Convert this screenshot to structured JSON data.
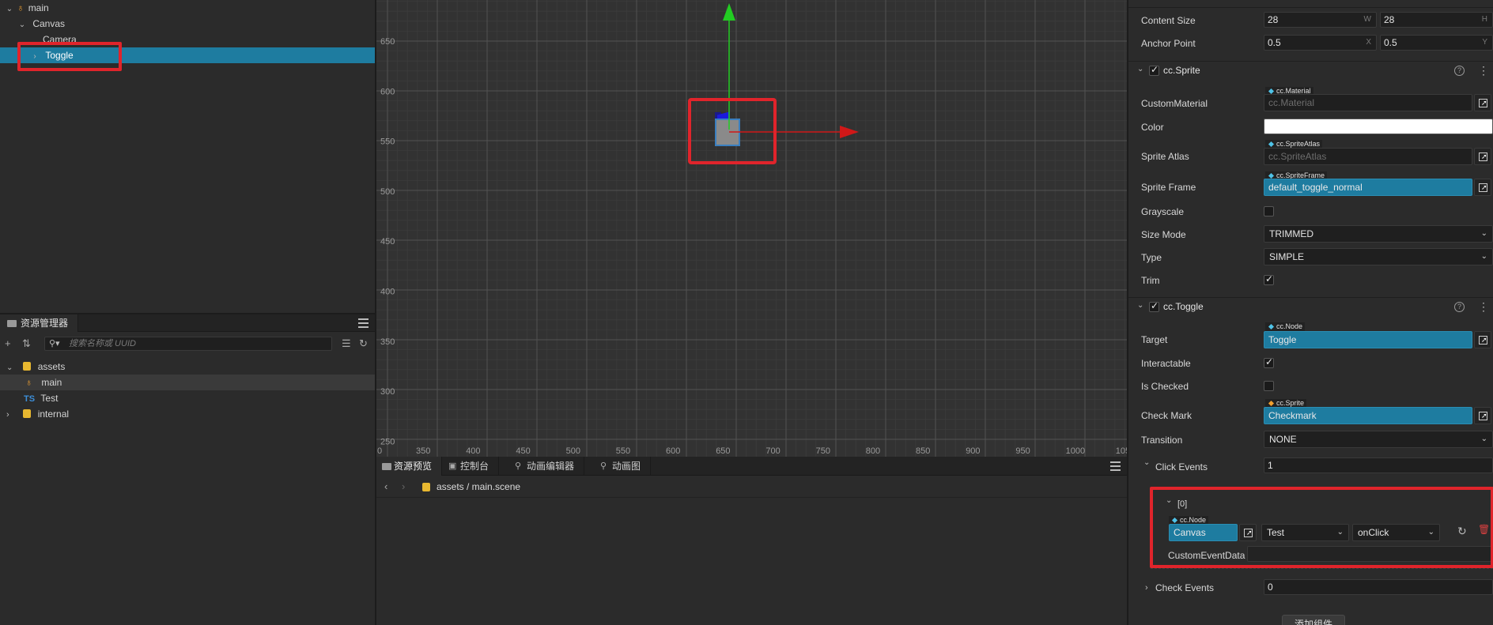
{
  "hierarchy": {
    "root": "main",
    "canvas": "Canvas",
    "camera": "Camera",
    "toggle": "Toggle"
  },
  "assets_panel": {
    "tab_label": "资源管理器",
    "search_placeholder": "搜索名称或 UUID",
    "items": {
      "assets": "assets",
      "main": "main",
      "test": "Test",
      "internal": "internal"
    },
    "ts_badge": "TS"
  },
  "scene": {
    "y_ticks": [
      "650",
      "600",
      "550",
      "500",
      "450",
      "400",
      "350",
      "300",
      "250"
    ],
    "x_ticks": [
      "0",
      "350",
      "400",
      "450",
      "500",
      "550",
      "600",
      "650",
      "700",
      "750",
      "800",
      "850",
      "900",
      "950",
      "1000",
      "105"
    ],
    "gizmo_colors": {
      "x_axis": "#d01818",
      "y_axis": "#22cc22",
      "z_axis": "#1a1adc",
      "highlight": "#e0242b"
    }
  },
  "bottom_panel": {
    "tabs": [
      "资源预览",
      "控制台",
      "动画编辑器",
      "动画图"
    ],
    "path": "assets / main.scene"
  },
  "inspector": {
    "content_size": {
      "label": "Content Size",
      "w": "28",
      "w_unit": "W",
      "h": "28",
      "h_unit": "H"
    },
    "anchor_point": {
      "label": "Anchor Point",
      "x": "0.5",
      "x_unit": "X",
      "y": "0.5",
      "y_unit": "Y"
    },
    "sprite": {
      "title": "cc.Sprite",
      "custom_material": {
        "label": "CustomMaterial",
        "tag": "cc.Material",
        "value": "cc.Material"
      },
      "color": {
        "label": "Color",
        "value": "#ffffff"
      },
      "sprite_atlas": {
        "label": "Sprite Atlas",
        "tag": "cc.SpriteAtlas",
        "value": "cc.SpriteAtlas"
      },
      "sprite_frame": {
        "label": "Sprite Frame",
        "tag": "cc.SpriteFrame",
        "value": "default_toggle_normal"
      },
      "grayscale": {
        "label": "Grayscale",
        "checked": false
      },
      "size_mode": {
        "label": "Size Mode",
        "value": "TRIMMED"
      },
      "type": {
        "label": "Type",
        "value": "SIMPLE"
      },
      "trim": {
        "label": "Trim",
        "checked": true
      }
    },
    "toggle": {
      "title": "cc.Toggle",
      "target": {
        "label": "Target",
        "tag": "cc.Node",
        "value": "Toggle"
      },
      "interactable": {
        "label": "Interactable",
        "checked": true
      },
      "is_checked": {
        "label": "Is Checked",
        "checked": false
      },
      "check_mark": {
        "label": "Check Mark",
        "tag": "cc.Sprite",
        "value": "Checkmark"
      },
      "transition": {
        "label": "Transition",
        "value": "NONE"
      },
      "click_events": {
        "label": "Click Events",
        "count": "1"
      },
      "event0": {
        "index": "[0]",
        "tag": "cc.Node",
        "node": "Canvas",
        "component": "Test",
        "handler": "onClick",
        "custom_data_label": "CustomEventData"
      },
      "check_events": {
        "label": "Check Events",
        "count": "0"
      }
    },
    "add_component": "添加组件"
  }
}
